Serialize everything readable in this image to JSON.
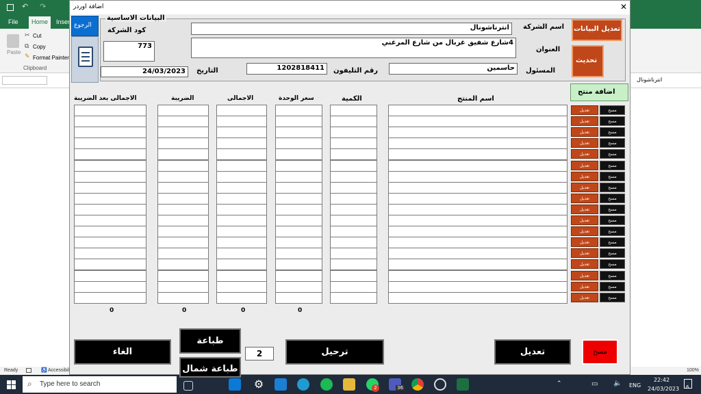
{
  "excel": {
    "tabs": [
      "File",
      "Home",
      "Inser"
    ],
    "clipboard": {
      "cut": "Cut",
      "copy": "Copy",
      "paste": "Paste",
      "format_painter": "Format Painter",
      "group": "Clipboard"
    },
    "formula_value": "انترناشونال",
    "status": {
      "ready": "Ready",
      "accessibility": "Accessibili",
      "zoom": "100%"
    }
  },
  "dialog": {
    "title": "اضافة اوردر",
    "back_button": "الرجوع",
    "basic_data_label": "البيانات الاساسية",
    "company_code_label": "كود الشركة",
    "company_code": "773",
    "date_label": "التاريخ",
    "date": "24/03/2023",
    "company_name_label": "اسم الشركة",
    "company_name": "انترناشونال",
    "address_label": "العنوان",
    "address": "4شارع شفيق غربال من شارع المرغني",
    "phone_label": "رقم التليفون",
    "phone": "1202818411",
    "manager_label": "المسئول",
    "manager": "حاسمين",
    "edit_data_button": "تعديل البيانات",
    "update_button": "تحديث",
    "add_product_button": "اضافة منتج",
    "columns": {
      "product_name": "اسم المنتج",
      "quantity": "الكمية",
      "unit_price": "سعر الوحدة",
      "total": "الاجمالى",
      "tax": "الضريبة",
      "total_after_tax": "الاجمالى بعد الضريبة"
    },
    "row_edit_label": "تعديل",
    "row_delete_label": "مسح",
    "totals": {
      "unit_price": "0",
      "total": "0",
      "tax": "0",
      "total_after_tax": "0"
    },
    "print_button": "طباعة",
    "print_shamal_button": "طباعة شمال",
    "order_count": "2",
    "cancel_button": "الغاء",
    "post_button": "ترحيل",
    "edit_button": "تعديل",
    "delete_button": "مسح"
  },
  "taskbar": {
    "search_placeholder": "Type here to search",
    "language": "ENG",
    "time": "22:42",
    "date": "24/03/2023",
    "notification_count": "6",
    "badges": {
      "whatsapp": "2",
      "teams": "36"
    }
  }
}
